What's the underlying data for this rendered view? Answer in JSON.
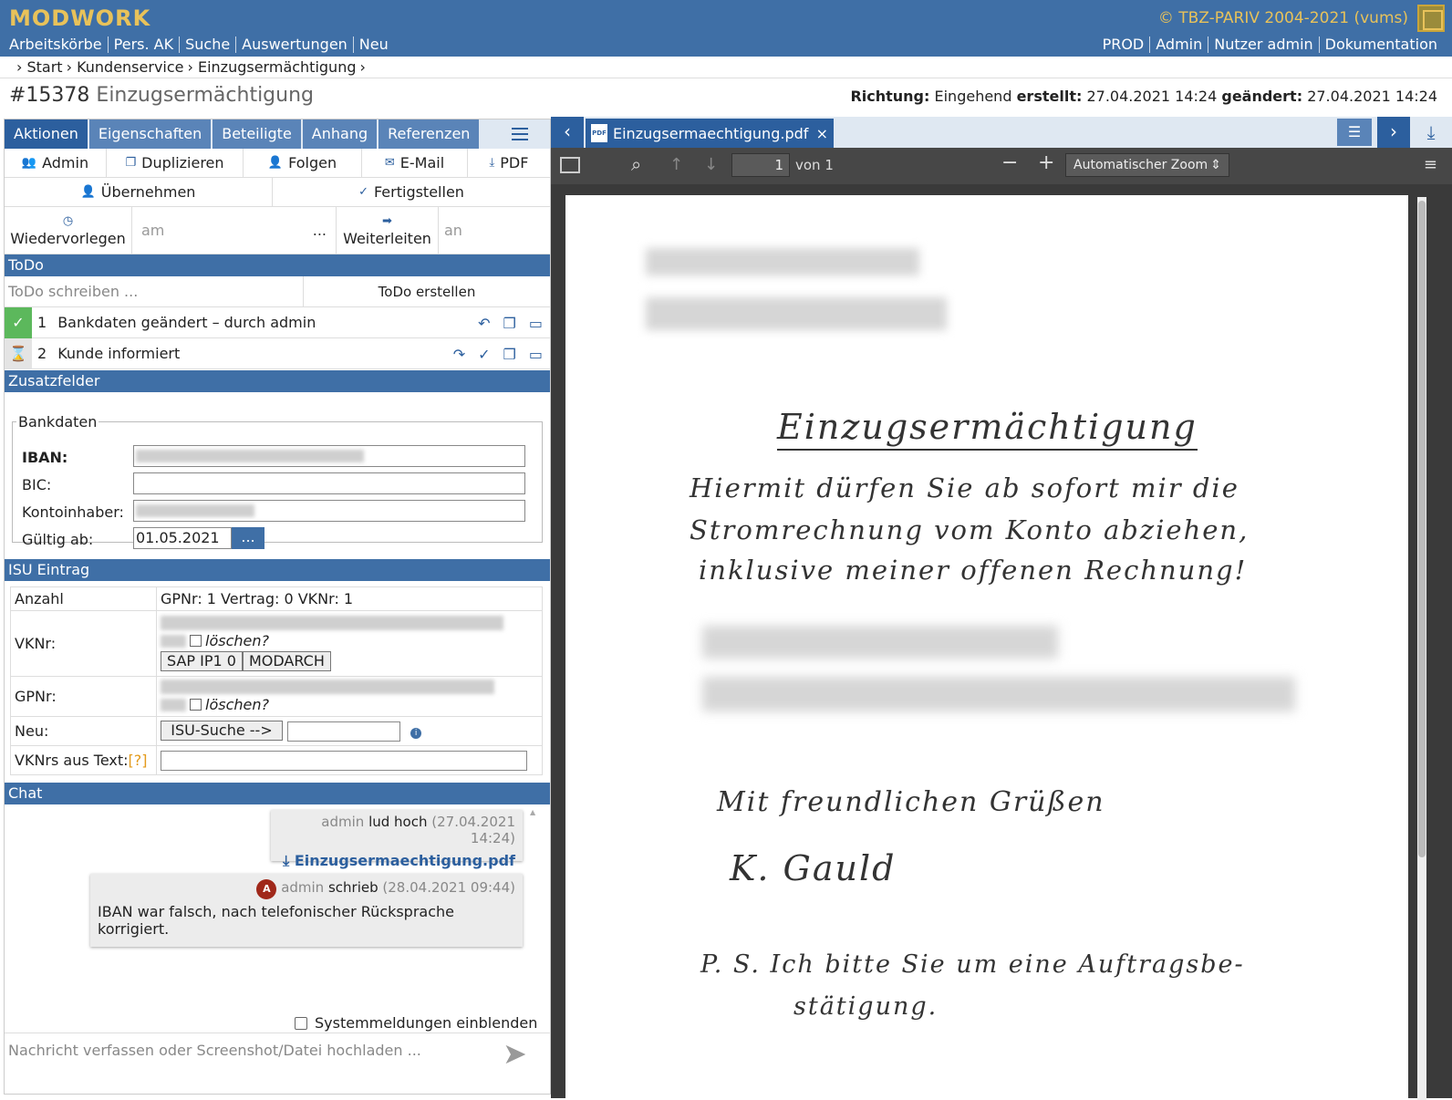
{
  "header": {
    "brand": "MODWORK",
    "copyright": "© TBZ-PARIV 2004-2021 (vums)",
    "nav_left": [
      "Arbeitskörbe",
      "Pers. AK",
      "Suche",
      "Auswertungen",
      "Neu"
    ],
    "nav_right": [
      "PROD",
      "Admin",
      "Nutzer admin",
      "Dokumentation"
    ]
  },
  "breadcrumb": [
    "› Start",
    "› Kundenservice",
    "› Einzugsermächtigung",
    "›"
  ],
  "ticket": {
    "number": "#15378",
    "title": "Einzugsermächtigung",
    "richtung_label": "Richtung:",
    "richtung": "Eingehend",
    "erstellt_label": "erstellt:",
    "erstellt": "27.04.2021 14:24",
    "geaendert_label": "geändert:",
    "geaendert": "27.04.2021 14:24"
  },
  "tabs": [
    "Aktionen",
    "Eigenschaften",
    "Beteiligte",
    "Anhang",
    "Referenzen"
  ],
  "actions": [
    "Admin",
    "Duplizieren",
    "Folgen",
    "E-Mail",
    "PDF"
  ],
  "actions2": [
    "Übernehmen",
    "Fertigstellen"
  ],
  "resubmit": {
    "label": "Wiedervorlegen",
    "date_placeholder": "am",
    "ellipsis": "...",
    "forward": "Weiterleiten",
    "to_placeholder": "an"
  },
  "todo": {
    "title": "ToDo",
    "placeholder": "ToDo schreiben ...",
    "create": "ToDo erstellen",
    "items": [
      {
        "num": "1",
        "text": "Bankdaten geändert – durch admin",
        "status": "done"
      },
      {
        "num": "2",
        "text": "Kunde informiert",
        "status": "pending"
      }
    ]
  },
  "zusatzfelder": {
    "title": "Zusatzfelder",
    "legend": "Bankdaten",
    "iban_label": "IBAN:",
    "bic_label": "BIC:",
    "inhaber_label": "Kontoinhaber:",
    "gueltig_label": "Gültig ab:",
    "gueltig_value": "01.05.2021",
    "date_btn": "..."
  },
  "isu": {
    "title": "ISU Eintrag",
    "anzahl_label": "Anzahl",
    "anzahl_value": "GPNr: 1 Vertrag: 0 VKNr: 1",
    "vknr_label": "VKNr:",
    "loeschen": "löschen?",
    "sap_btn": "SAP IP1 0",
    "modarch_btn": "MODARCH",
    "gpnr_label": "GPNr:",
    "neu_label": "Neu:",
    "isu_btn": "ISU-Suche -->",
    "vknrs_label": "VKNrs aus Text:",
    "help": "[?]"
  },
  "chat": {
    "title": "Chat",
    "msg1_user": "admin",
    "msg1_action": "lud hoch",
    "msg1_time": "(27.04.2021 14:24)",
    "msg1_file": "Einzugsermaechtigung.pdf",
    "msg2_avatar": "A",
    "msg2_user": "admin",
    "msg2_action": "schrieb",
    "msg2_time": "(28.04.2021 09:44)",
    "msg2_text": "IBAN war falsch, nach telefonischer Rücksprache korrigiert.",
    "system_label": "Systemmeldungen einblenden",
    "input_placeholder": "Nachricht verfassen oder Screenshot/Datei hochladen ..."
  },
  "viewer": {
    "file_tab": "Einzugsermaechtigung.pdf",
    "page": "1",
    "page_of": "von 1",
    "zoom": "Automatischer Zoom",
    "doc_title": "Einzugsermächtigung",
    "doc_lines": [
      "Hiermit dürfen Sie ab sofort mir die",
      "Stromrechnung vom Konto abziehen,",
      "inklusive meiner offenen Rechnung!"
    ],
    "greeting": "Mit freundlichen Grüßen",
    "signature": "K. Gauld",
    "ps_lines": [
      "P. S.   Ich bitte Sie um eine Auftragsbe-",
      "stätigung."
    ]
  },
  "colors": {
    "primary": "#3f6fa6",
    "brand": "#e8c25a",
    "done": "#5cb85c"
  }
}
